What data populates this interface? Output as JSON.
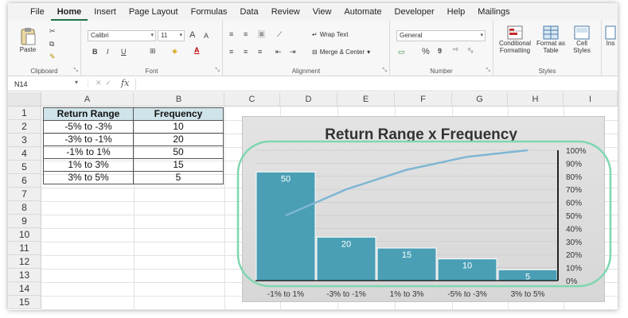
{
  "menu": {
    "tabs": [
      "File",
      "Home",
      "Insert",
      "Page Layout",
      "Formulas",
      "Data",
      "Review",
      "View",
      "Automate",
      "Developer",
      "Help",
      "Mailings"
    ],
    "active": "Home"
  },
  "ribbon": {
    "clipboard": {
      "label": "Clipboard",
      "paste": "Paste"
    },
    "font": {
      "label": "Font",
      "name": "Calibri",
      "size": "11",
      "grow": "A",
      "shrink": "A",
      "bold": "B",
      "italic": "I",
      "underline": "U"
    },
    "alignment": {
      "label": "Alignment",
      "wrap_text": "Wrap Text",
      "merge_center": "Merge & Center"
    },
    "number": {
      "label": "Number",
      "format": "General",
      "percent": "%",
      "comma": "9"
    },
    "styles": {
      "label": "Styles",
      "conditional_1": "Conditional",
      "conditional_2": "Formatting",
      "format_table_1": "Format as",
      "format_table_2": "Table",
      "cell_styles_1": "Cell",
      "cell_styles_2": "Styles"
    },
    "insert_partial": "Ins"
  },
  "formula_bar": {
    "name_box": "N14",
    "fx": "fx",
    "value": ""
  },
  "columns": [
    "A",
    "B",
    "C",
    "D",
    "E",
    "F",
    "G",
    "H",
    "I"
  ],
  "rows": [
    "1",
    "2",
    "3",
    "4",
    "5",
    "6",
    "7",
    "8",
    "9",
    "10",
    "11",
    "12",
    "13",
    "14",
    "15"
  ],
  "table": {
    "headers": [
      "Return Range",
      "Frequency"
    ],
    "rows": [
      [
        "-5% to -3%",
        "10"
      ],
      [
        "-3% to -1%",
        "20"
      ],
      [
        "-1% to 1%",
        "50"
      ],
      [
        "1% to 3%",
        "15"
      ],
      [
        "3% to 5%",
        "5"
      ]
    ]
  },
  "colors": {
    "bar": "#4a9fb5",
    "line": "#7fb6d3",
    "highlight": "#7fd6b0",
    "header_fill": "#cfe3ea",
    "accent": "#1e7145"
  },
  "chart_data": {
    "type": "bar",
    "title": "Return Range x Frequency",
    "categories": [
      "-1% to 1%",
      "-3% to -1%",
      "1% to 3%",
      "-5% to -3%",
      "3% to 5%"
    ],
    "values": [
      50,
      20,
      15,
      10,
      5
    ],
    "data_labels": [
      "50",
      "20",
      "15",
      "10",
      "5"
    ],
    "line_values": [
      50,
      70,
      85,
      95,
      100
    ],
    "ylim": [
      0,
      60
    ],
    "secondary_ylim": [
      0,
      100
    ],
    "secondary_ticks": [
      "0%",
      "10%",
      "20%",
      "30%",
      "40%",
      "50%",
      "60%",
      "70%",
      "80%",
      "90%",
      "100%"
    ],
    "grid": true,
    "legend": "none"
  }
}
